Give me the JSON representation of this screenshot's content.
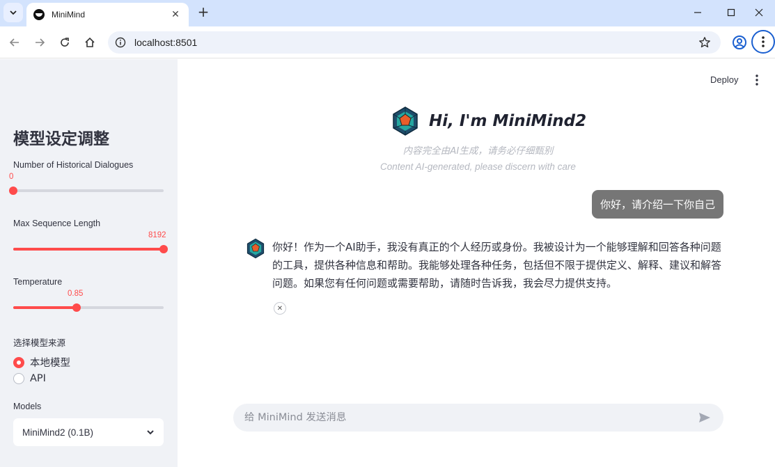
{
  "browser": {
    "tab_title": "MiniMind",
    "url": "localhost:8501"
  },
  "sidebar": {
    "title": "模型设定调整",
    "history": {
      "label": "Number of Historical Dialogues",
      "value": "0",
      "fraction": 0.0
    },
    "max_seq": {
      "label": "Max Sequence Length",
      "value": "8192",
      "fraction": 1.0
    },
    "temperature": {
      "label": "Temperature",
      "value": "0.85",
      "fraction": 0.42
    },
    "source": {
      "label": "选择模型来源",
      "options": [
        {
          "label": "本地模型",
          "selected": true
        },
        {
          "label": "API",
          "selected": false
        }
      ]
    },
    "models": {
      "label": "Models",
      "selected": "MiniMind2 (0.1B)"
    }
  },
  "main": {
    "deploy_label": "Deploy",
    "greeting": "Hi, I'm MiniMind2",
    "notice_cn": "内容完全由AI生成，请务必仔细甄别",
    "notice_en": "Content AI-generated, please discern with care",
    "user_message": "你好，请介绍一下你自己",
    "bot_message": "你好！作为一个AI助手，我没有真正的个人经历或身份。我被设计为一个能够理解和回答各种问题的工具，提供各种信息和帮助。我能够处理各种任务，包括但不限于提供定义、解释、建议和解答问题。如果您有任何问题或需要帮助，请随时告诉我，我会尽力提供支持。",
    "copy_glyph": "✕",
    "input_placeholder": "给 MiniMind 发送消息"
  },
  "colors": {
    "accent": "#ff4b4b",
    "sidebar_bg": "#f0f2f6",
    "user_bubble": "#767676"
  }
}
